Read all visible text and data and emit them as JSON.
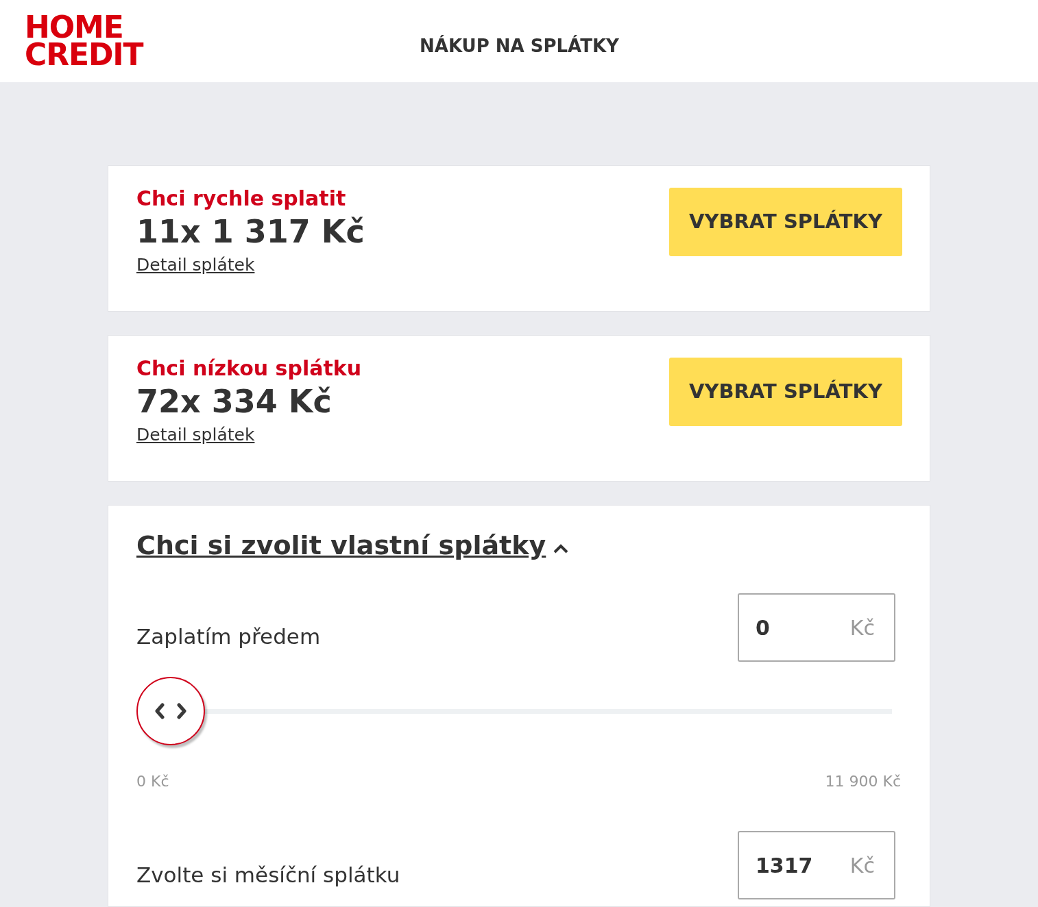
{
  "header": {
    "logo": [
      "HOME",
      "CREDIT"
    ],
    "title": "NÁKUP NA SPLÁTKY"
  },
  "offers": [
    {
      "title": "Chci rychle splatit",
      "amount": "11x 1 317 Kč",
      "link": "Detail splátek",
      "button": "VYBRAT SPLÁTKY"
    },
    {
      "title": "Chci nízkou splátku",
      "amount": "72x 334 Kč",
      "link": "Detail splátek",
      "button": "VYBRAT SPLÁTKY"
    }
  ],
  "custom": {
    "title": "Chci si zvolit vlastní splátky",
    "expanded": true,
    "controls": [
      {
        "kind": "slider",
        "label": "Zaplatím předem",
        "value": "0",
        "unit": "Kč",
        "level": 0,
        "min": "0 Kč",
        "max": "11 900 Kč"
      },
      {
        "kind": "input",
        "label": "Zvolte si měsíční splátku",
        "value": "1317",
        "unit": "Kč"
      }
    ]
  }
}
